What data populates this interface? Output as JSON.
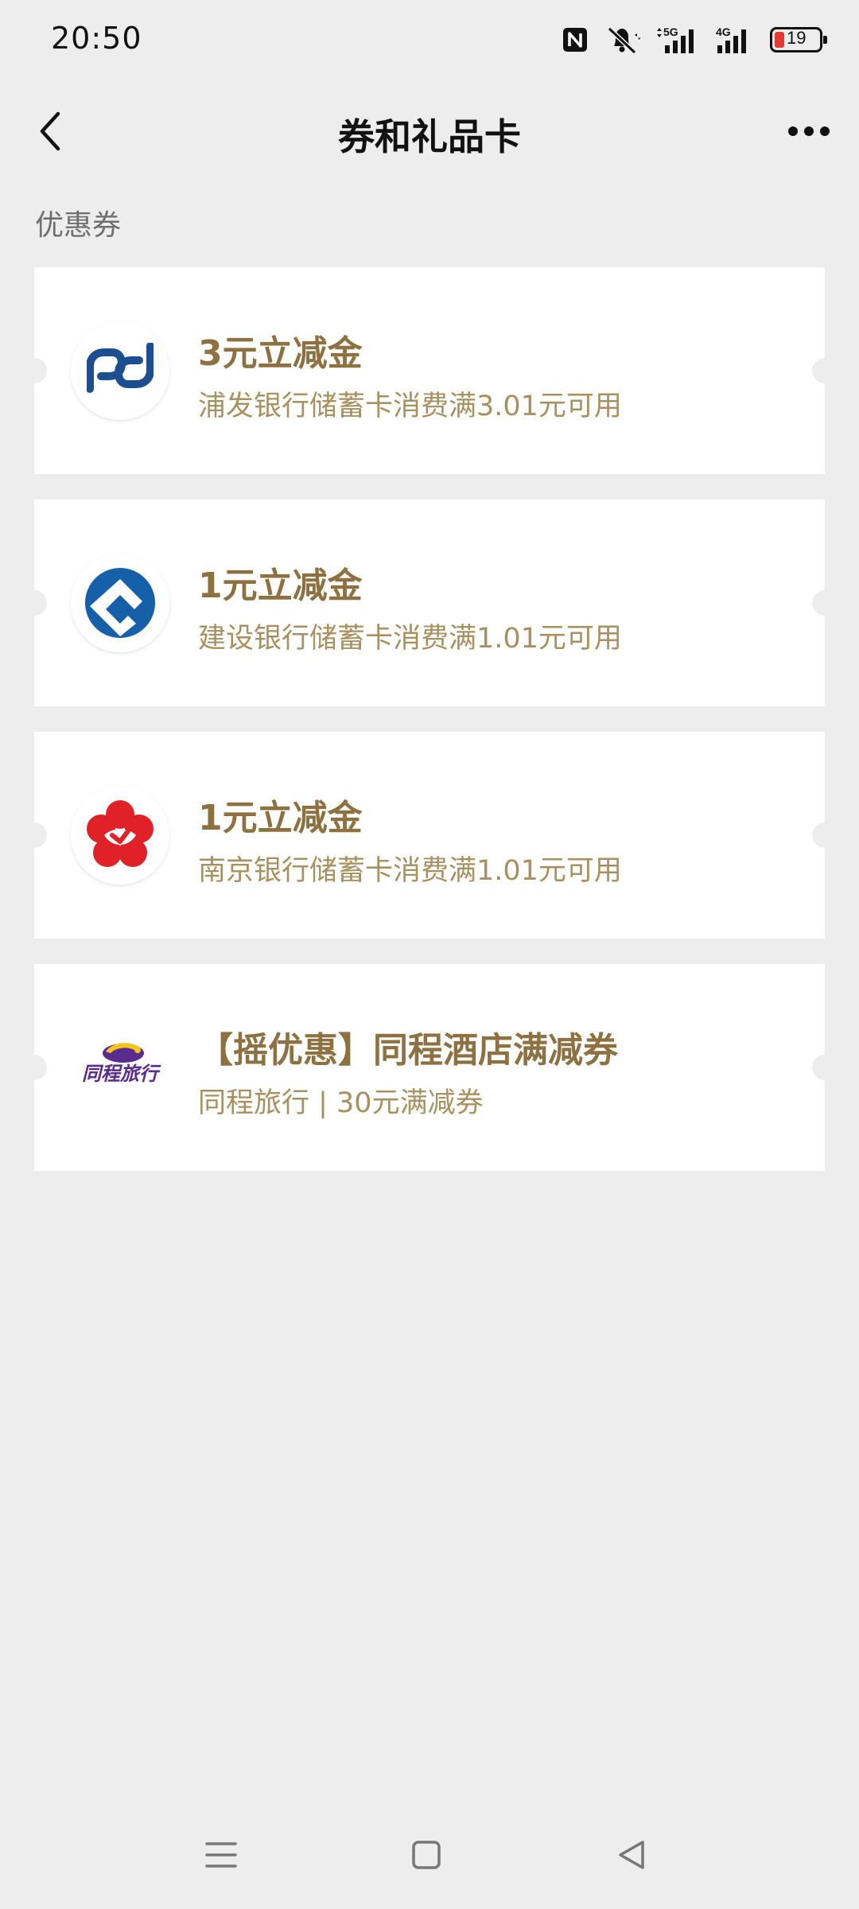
{
  "status_bar": {
    "time": "20:50",
    "battery_level": "19",
    "network_5g": "5G",
    "network_4g": "4G"
  },
  "nav": {
    "title": "券和礼品卡"
  },
  "section": {
    "label": "优惠券"
  },
  "coupons": [
    {
      "title": "3元立减金",
      "desc": "浦发银行储蓄卡消费满3.01元可用",
      "logo": "spdb-logo-icon"
    },
    {
      "title": "1元立减金",
      "desc": "建设银行储蓄卡消费满1.01元可用",
      "logo": "ccb-logo-icon"
    },
    {
      "title": "1元立减金",
      "desc": "南京银行储蓄卡消费满1.01元可用",
      "logo": "bank-of-nanjing-logo-icon"
    },
    {
      "title": "【摇优惠】同程酒店满减券",
      "desc": "同程旅行 | 30元满减券",
      "logo": "tongcheng-logo-icon",
      "logo_text": "同程旅行"
    }
  ],
  "colors": {
    "background": "#ededed",
    "card": "#ffffff",
    "title_gold": "#8d7141",
    "desc_gold": "#a8905f",
    "spdb_blue": "#1d4e8f",
    "ccb_blue": "#1560a8",
    "nanjing_red": "#e02128",
    "tongcheng_purple": "#5b2c8f"
  }
}
